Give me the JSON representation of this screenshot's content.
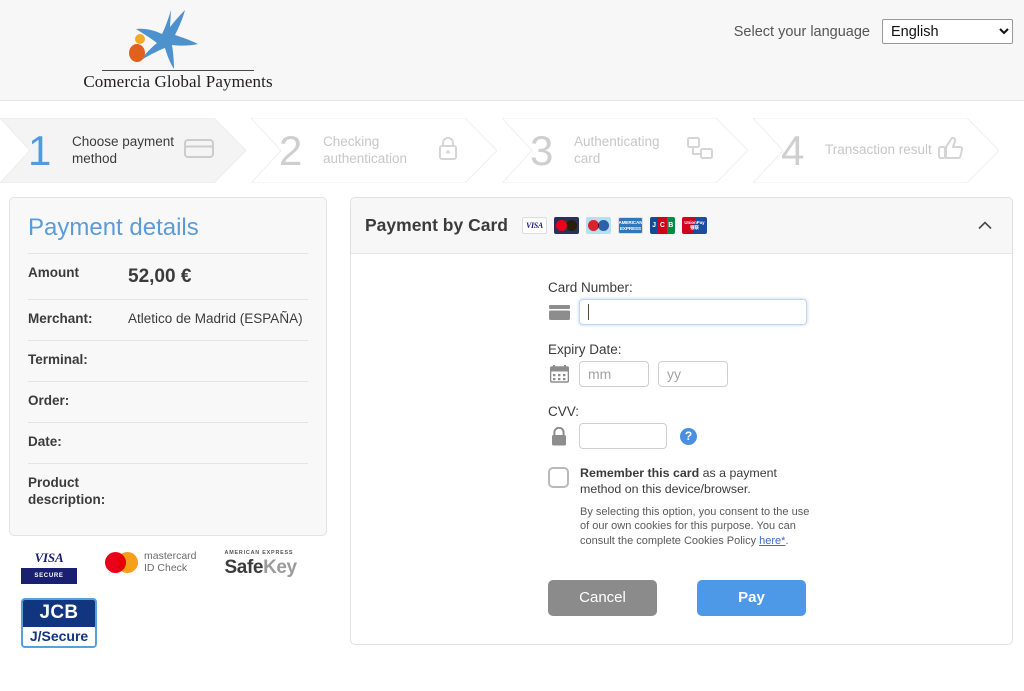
{
  "header": {
    "logo_text": "Comercia Global Payments",
    "language_label": "Select your language",
    "language_value": "English",
    "language_options": [
      "English"
    ]
  },
  "stepper": {
    "steps": [
      {
        "number": "1",
        "label": "Choose payment method",
        "icon": "credit-card-icon",
        "state": "active"
      },
      {
        "number": "2",
        "label": "Checking authentication",
        "icon": "lock-icon",
        "state": "idle"
      },
      {
        "number": "3",
        "label": "Authenticating card",
        "icon": "network-icon",
        "state": "idle"
      },
      {
        "number": "4",
        "label": "Transaction result",
        "icon": "thumbs-up-icon",
        "state": "idle"
      }
    ]
  },
  "payment_details": {
    "title": "Payment details",
    "rows": [
      {
        "key": "Amount",
        "value": "52,00 €"
      },
      {
        "key": "Merchant:",
        "value": "Atletico de Madrid (ESPAÑA)"
      },
      {
        "key": "Terminal:",
        "value": ""
      },
      {
        "key": "Order:",
        "value": ""
      },
      {
        "key": "Date:",
        "value": ""
      },
      {
        "key": "Product description:",
        "value": ""
      }
    ]
  },
  "security_badges": [
    {
      "name": "visa-secure-badge",
      "top": "VISA",
      "bottom": "SECURE"
    },
    {
      "name": "mastercard-id-check-badge",
      "line1": "mastercard",
      "line2": "ID Check"
    },
    {
      "name": "amex-safekey-badge",
      "top": "AMERICAN EXPRESS",
      "main_a": "Safe",
      "main_b": "Key"
    },
    {
      "name": "jcb-jsecure-badge",
      "top": "JCB",
      "bottom": "J/Secure"
    }
  ],
  "payment_panel": {
    "title": "Payment by Card",
    "card_brands": [
      "visa-icon",
      "mastercard-icon",
      "maestro-icon",
      "amex-icon",
      "jcb-icon",
      "unionpay-icon"
    ],
    "amex_label": "AMERICAN EXPRESS",
    "jcb_letters": [
      "J",
      "C",
      "B"
    ],
    "unionpay_label": "UnionPay 银联",
    "visa_label": "VISA",
    "collapse_icon": "chevron-up-icon",
    "fields": {
      "card_number_label": "Card Number:",
      "card_number_value": "",
      "card_number_placeholder": "",
      "expiry_label": "Expiry Date:",
      "expiry_mm_value": "",
      "expiry_mm_placeholder": "mm",
      "expiry_yy_value": "",
      "expiry_yy_placeholder": "yy",
      "cvv_label": "CVV:",
      "cvv_value": "",
      "cvv_placeholder": "",
      "cvv_help": "?"
    },
    "remember": {
      "strong": "Remember this card",
      "rest": " as a payment method on this device/browser.",
      "consent_before": "By selecting this option, you consent to the use of our own cookies for this purpose. You can consult the complete Cookies Policy ",
      "consent_link": "here*",
      "consent_after": "."
    },
    "buttons": {
      "cancel": "Cancel",
      "pay": "Pay"
    }
  },
  "colors": {
    "accent_blue": "#4e98e8",
    "title_blue": "#5b9bdb",
    "step_active_blue": "#4f9ae3",
    "cancel_gray": "#8b8b8b",
    "link_blue": "#3a6fc4"
  }
}
